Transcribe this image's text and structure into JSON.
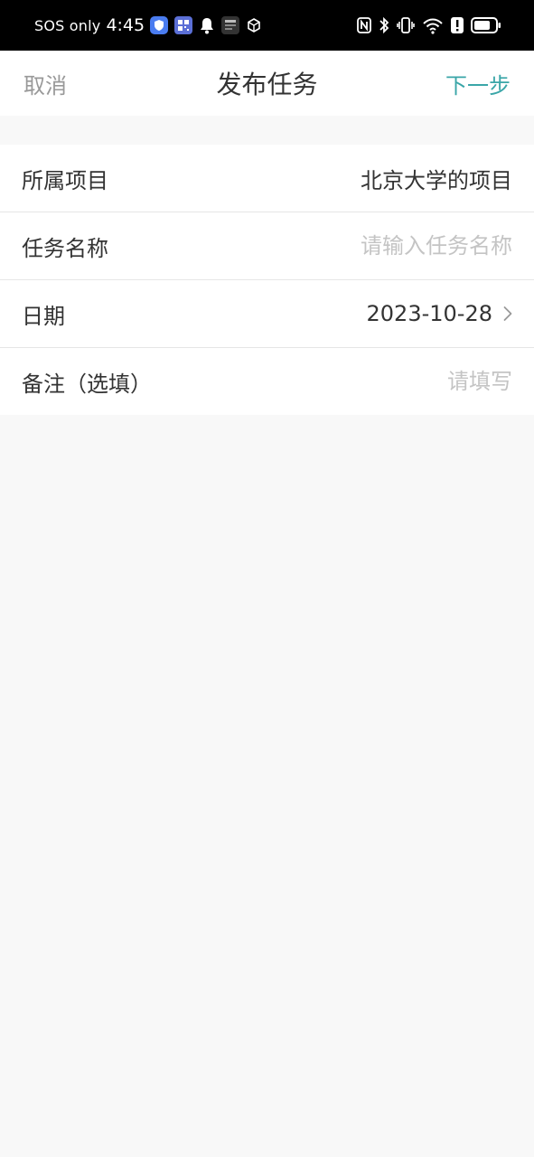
{
  "status_bar": {
    "carrier_text": "SOS only",
    "time": "4:45",
    "left_icons": [
      "shield-app-icon",
      "qr-app-icon",
      "notification-bell-icon",
      "app-thumbnail-icon",
      "box-app-icon"
    ],
    "right_icons": [
      "nfc-icon",
      "bluetooth-icon",
      "vibrate-icon",
      "wifi-icon",
      "alert-icon",
      "battery-icon"
    ],
    "battery_level": 0.75
  },
  "nav": {
    "cancel_label": "取消",
    "title": "发布任务",
    "next_label": "下一步",
    "accent_color": "#3aa6a8"
  },
  "form": {
    "project": {
      "label": "所属项目",
      "value": "北京大学的项目"
    },
    "task_name": {
      "label": "任务名称",
      "value": "",
      "placeholder": "请输入任务名称"
    },
    "date": {
      "label": "日期",
      "value": "2023-10-28",
      "icon": "chevron-right-icon"
    },
    "note": {
      "label": "备注（选填）",
      "value": "",
      "placeholder": "请填写"
    }
  }
}
